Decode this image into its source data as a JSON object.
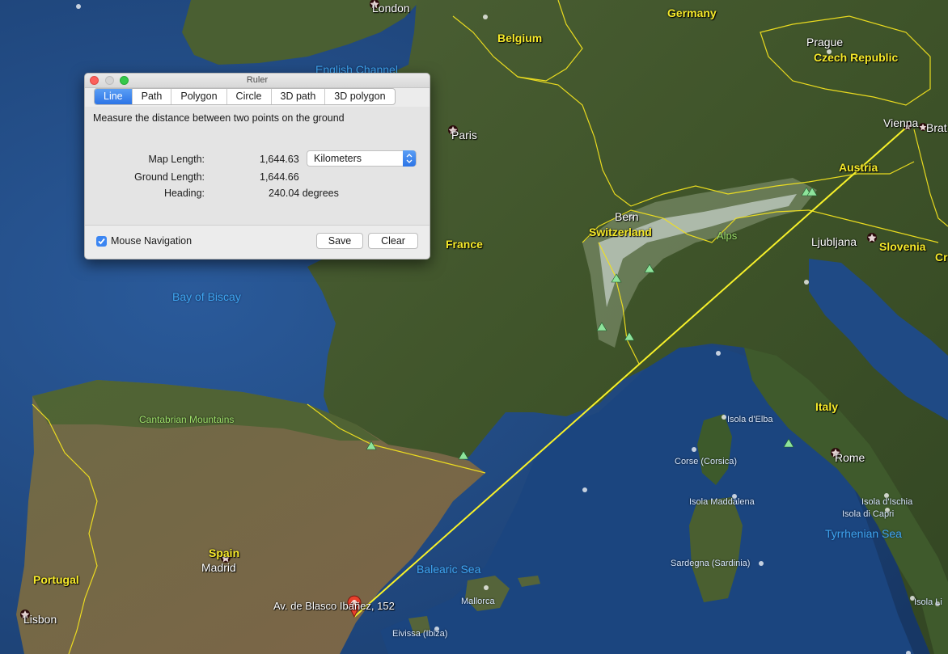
{
  "map": {
    "countries": [
      {
        "id": "germany",
        "text": "Germany"
      },
      {
        "id": "belgium",
        "text": "Belgium"
      },
      {
        "id": "czech",
        "text": "Czech Republic"
      },
      {
        "id": "france",
        "text": "France"
      },
      {
        "id": "switzerland",
        "text": "Switzerland"
      },
      {
        "id": "austria",
        "text": "Austria"
      },
      {
        "id": "slovenia",
        "text": "Slovenia"
      },
      {
        "id": "italy",
        "text": "Italy"
      },
      {
        "id": "spain",
        "text": "Spain"
      },
      {
        "id": "portugal",
        "text": "Portugal"
      },
      {
        "id": "croatia_partial",
        "text": "Cr"
      }
    ],
    "cities": [
      {
        "id": "london",
        "text": "London"
      },
      {
        "id": "prague",
        "text": "Prague"
      },
      {
        "id": "paris",
        "text": "Paris"
      },
      {
        "id": "vienna",
        "text": "Vienna"
      },
      {
        "id": "bratislava",
        "text": "Brat"
      },
      {
        "id": "bern",
        "text": "Bern"
      },
      {
        "id": "ljubljana",
        "text": "Ljubljana"
      },
      {
        "id": "rome",
        "text": "Rome"
      },
      {
        "id": "madrid",
        "text": "Madrid"
      },
      {
        "id": "lisbon",
        "text": "Lisbon"
      }
    ],
    "seas": [
      {
        "id": "english_channel",
        "text": "English Channel"
      },
      {
        "id": "bay_of_biscay",
        "text": "Bay of Biscay"
      },
      {
        "id": "balearic_sea",
        "text": "Balearic Sea"
      },
      {
        "id": "tyrrhenian_sea",
        "text": "Tyrrhenian Sea"
      }
    ],
    "features": [
      {
        "id": "alps",
        "text": "Alps"
      },
      {
        "id": "cantabrian",
        "text": "Cantabrian Mountains"
      }
    ],
    "islands": [
      {
        "id": "elba",
        "text": "Isola d'Elba"
      },
      {
        "id": "corse",
        "text": "Corse (Corsica)"
      },
      {
        "id": "maddalena",
        "text": "Isola Maddalena"
      },
      {
        "id": "sardegna",
        "text": "Sardegna (Sardinia)"
      },
      {
        "id": "mallorca",
        "text": "Mallorca"
      },
      {
        "id": "eivissa",
        "text": "Eivissa (Ibiza)"
      },
      {
        "id": "ischia",
        "text": "Isola d'Ischia"
      },
      {
        "id": "capri",
        "text": "Isola di Capri"
      },
      {
        "id": "lipari",
        "text": "Isola Li"
      }
    ],
    "placemark": {
      "text": "Av. de Blasco Ibáñez, 152"
    },
    "colors": {
      "border": "#f2e21f",
      "measure_line": "#f7f12a",
      "pin": "#e8402c"
    }
  },
  "ruler": {
    "title": "Ruler",
    "tabs": [
      "Line",
      "Path",
      "Polygon",
      "Circle",
      "3D path",
      "3D polygon"
    ],
    "active_tab": "Line",
    "description": "Measure the distance between two points on the ground",
    "map_length_label": "Map Length:",
    "map_length_value": "1,644.63",
    "unit_selected": "Kilometers",
    "ground_length_label": "Ground Length:",
    "ground_length_value": "1,644.66",
    "heading_label": "Heading:",
    "heading_value": "240.04 degrees",
    "mouse_nav_label": "Mouse Navigation",
    "mouse_nav_checked": true,
    "save_label": "Save",
    "clear_label": "Clear"
  }
}
